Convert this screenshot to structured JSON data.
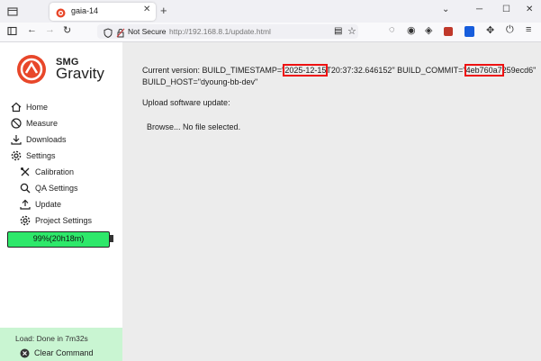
{
  "browser": {
    "tab_title": "gaia-14",
    "security_label": "Not Secure",
    "url": "http://192.168.8.1/update.html"
  },
  "brand": {
    "small": "SMG",
    "big": "Gravity"
  },
  "sidebar": {
    "items": [
      {
        "label": "Home",
        "icon": "home-icon"
      },
      {
        "label": "Measure",
        "icon": "measure-icon"
      },
      {
        "label": "Downloads",
        "icon": "download-icon"
      },
      {
        "label": "Settings",
        "icon": "gear-icon"
      }
    ],
    "subitems": [
      {
        "label": "Calibration",
        "icon": "tools-icon"
      },
      {
        "label": "QA Settings",
        "icon": "search-icon"
      },
      {
        "label": "Update",
        "icon": "upload-icon"
      },
      {
        "label": "Project Settings",
        "icon": "gear-icon"
      }
    ],
    "battery_label": "99%(20h18m)",
    "battery_level": 0.99,
    "status_text": "Load: Done in 7m32s",
    "clear_label": "Clear Command"
  },
  "main": {
    "version_prefix": "Current version: BUILD_TIMESTAMP=\"",
    "timestamp_date": "2025-12-15",
    "timestamp_rest": "T20:37:32.646152\" BUILD_COMMIT=\"",
    "commit_highlight": "4eb760a7",
    "commit_rest": "259ecd6\"",
    "build_host": "BUILD_HOST=\"dyoung-bb-dev\"",
    "upload_label": "Upload software update:",
    "browse_label": "Browse...",
    "file_status": "No file selected."
  },
  "colors": {
    "accent": "#e8472a",
    "battery_fill": "#2ee86a",
    "status_bg": "#c9f5d2",
    "highlight": "#ee1111"
  }
}
